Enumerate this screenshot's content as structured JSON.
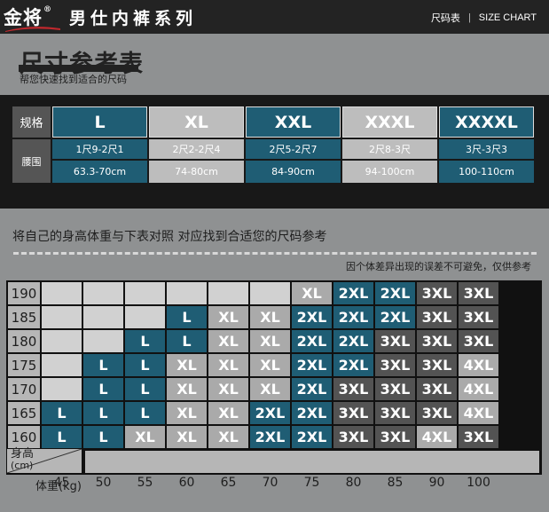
{
  "header": {
    "brand": "金将",
    "reg": "®",
    "series": "男仕内裤系列",
    "link_cn": "尺码表",
    "link_en": "SIZE CHART",
    "sep": "|"
  },
  "title": {
    "main": "尺寸参考表",
    "sub": "帮您快速找到适合的尺码"
  },
  "size_table": {
    "row_label_size": "规格",
    "row_label_waist": "腰围",
    "sizes": [
      "L",
      "XL",
      "XXL",
      "XXXL",
      "XXXXL"
    ],
    "waist_chi": [
      "1尺9-2尺1",
      "2尺2-2尺4",
      "2尺5-2尺7",
      "2尺8-3尺",
      "3尺-3尺3"
    ],
    "waist_cm": [
      "63.3-70cm",
      "74-80cm",
      "84-90cm",
      "94-100cm",
      "100-110cm"
    ]
  },
  "prompt": "将自己的身高体重与下表对照 对应找到合适您的尺码参考",
  "note": "因个体差异出现的误差不可避免，仅供参考",
  "chart": {
    "height_axis": {
      "label_line1": "身高",
      "label_line2": "(cm)"
    },
    "weight_axis": {
      "label": "体重(kg)"
    },
    "heights": [
      "190",
      "185",
      "180",
      "175",
      "170",
      "165",
      "160"
    ],
    "weights": [
      "45",
      "50",
      "55",
      "60",
      "65",
      "70",
      "75",
      "80",
      "85",
      "90",
      "100"
    ],
    "rows": [
      [
        "",
        "",
        "",
        "",
        "",
        "",
        "XL",
        "2XL",
        "2XL",
        "3XL",
        "3XL"
      ],
      [
        "",
        "",
        "",
        "L",
        "XL",
        "XL",
        "2XL",
        "2XL",
        "2XL",
        "3XL",
        "3XL"
      ],
      [
        "",
        "",
        "L",
        "L",
        "XL",
        "XL",
        "2XL",
        "2XL",
        "3XL",
        "3XL",
        "3XL"
      ],
      [
        "",
        "L",
        "L",
        "XL",
        "XL",
        "XL",
        "2XL",
        "2XL",
        "3XL",
        "3XL",
        "4XL"
      ],
      [
        "",
        "L",
        "L",
        "XL",
        "XL",
        "XL",
        "2XL",
        "3XL",
        "3XL",
        "3XL",
        "4XL"
      ],
      [
        "L",
        "L",
        "L",
        "XL",
        "XL",
        "2XL",
        "2XL",
        "3XL",
        "3XL",
        "3XL",
        "4XL"
      ],
      [
        "L",
        "L",
        "XL",
        "XL",
        "XL",
        "2XL",
        "2XL",
        "3XL",
        "3XL",
        "4XL",
        "3XL"
      ]
    ],
    "colors": {
      "L": "#1f5d74",
      "XL": "#aaaaaa",
      "2XL": "#1f5d74",
      "3XL": "#535353",
      "4XL": "#aaaaaa",
      "empty": "#d1d1d1"
    }
  }
}
